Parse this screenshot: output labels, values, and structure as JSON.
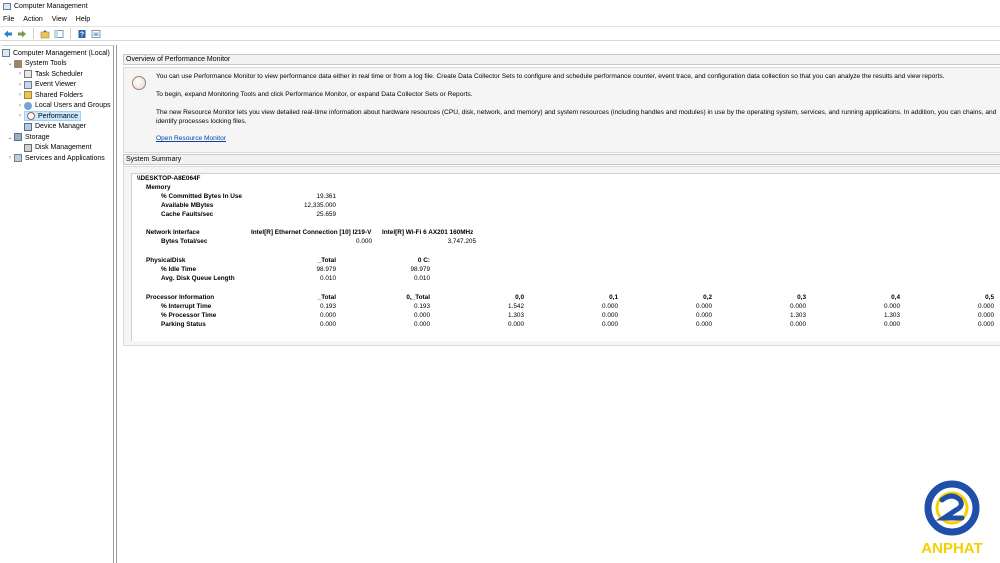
{
  "window": {
    "title": "Computer Management"
  },
  "menu": [
    "File",
    "Action",
    "View",
    "Help"
  ],
  "tree": {
    "root": "Computer Management (Local)",
    "system_tools": "System Tools",
    "items": [
      "Task Scheduler",
      "Event Viewer",
      "Shared Folders",
      "Local Users and Groups",
      "Performance",
      "Device Manager"
    ],
    "storage": "Storage",
    "disk_management": "Disk Management",
    "services": "Services and Applications"
  },
  "overview": {
    "title": "Overview of Performance Monitor",
    "p1": "You can use Performance Monitor to view performance data either in real time or from a log file. Create Data Collector Sets to configure and schedule performance counter, event trace, and configuration data collection so that you can analyze the results and view reports.",
    "p2": "To begin, expand Monitoring Tools and click Performance Monitor, or expand Data Collector Sets or Reports.",
    "p3": "The new Resource Monitor lets you view detailed real-time information about hardware resources (CPU, disk, network, and memory) and system resources (including handles and modules) in use by the operating system, services, and running applications. In addition, you can chains, and identify processes locking files.",
    "link": "Open Resource Monitor"
  },
  "summary": {
    "title": "System Summary",
    "host": "\\\\DESKTOP-A8E064F",
    "memory": {
      "label": "Memory",
      "rows": [
        {
          "name": "% Committed Bytes In Use",
          "value": "19.361"
        },
        {
          "name": "Available MBytes",
          "value": "12,335.000"
        },
        {
          "name": "Cache Faults/sec",
          "value": "25.659"
        }
      ]
    },
    "network": {
      "label": "Network Interface",
      "col1": "Intel[R] Ethernet Connection [10] I219-V",
      "col2": "Intel[R] Wi-Fi 6 AX201 160MHz",
      "row_name": "Bytes Total/sec",
      "v1": "0.000",
      "v2": "3,747.205"
    },
    "disk": {
      "label": "PhysicalDisk",
      "col1": "_Total",
      "col2": "0 C:",
      "rows": [
        {
          "name": "% Idle Time",
          "v1": "98.979",
          "v2": "98.979"
        },
        {
          "name": "Avg. Disk Queue Length",
          "v1": "0.010",
          "v2": "0.010"
        }
      ]
    },
    "processor": {
      "label": "Processor Information",
      "cols": [
        "_Total",
        "0,_Total",
        "0,0",
        "0,1",
        "0,2",
        "0,3",
        "0,4",
        "0,5"
      ],
      "rows": [
        {
          "name": "% Interrupt Time",
          "values": [
            "0.193",
            "0.193",
            "1.542",
            "0.000",
            "0.000",
            "0.000",
            "0.000",
            "0.000"
          ]
        },
        {
          "name": "% Processor Time",
          "values": [
            "0.000",
            "0.000",
            "1.303",
            "0.000",
            "0.000",
            "1.303",
            "1.303",
            "0.000"
          ]
        },
        {
          "name": "Parking Status",
          "values": [
            "0.000",
            "0.000",
            "0.000",
            "0.000",
            "0.000",
            "0.000",
            "0.000",
            "0.000"
          ]
        }
      ]
    }
  },
  "watermark": {
    "text": "ANPHAT",
    "colors": {
      "blue": "#1f4fa8",
      "yellow": "#f5d000"
    }
  }
}
